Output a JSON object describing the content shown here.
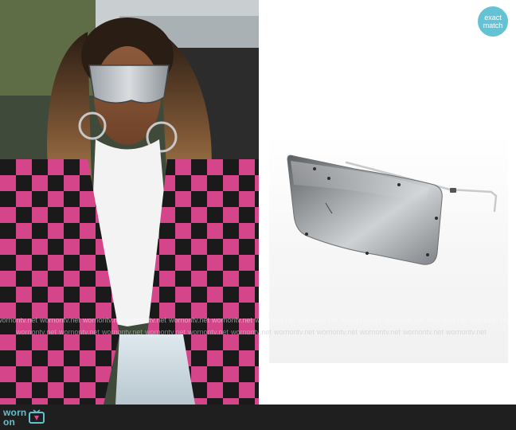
{
  "badge": {
    "line1": "exact",
    "line2": "match"
  },
  "watermark": {
    "text": "wornontv.net"
  },
  "footer": {
    "logo_text_line1": "worn",
    "logo_text_line2": "on"
  },
  "colors": {
    "badge": "#63c2d4",
    "footer": "#1f1f1f",
    "logo": "#62c0cf"
  },
  "icons": {
    "tv": "tv-icon"
  }
}
